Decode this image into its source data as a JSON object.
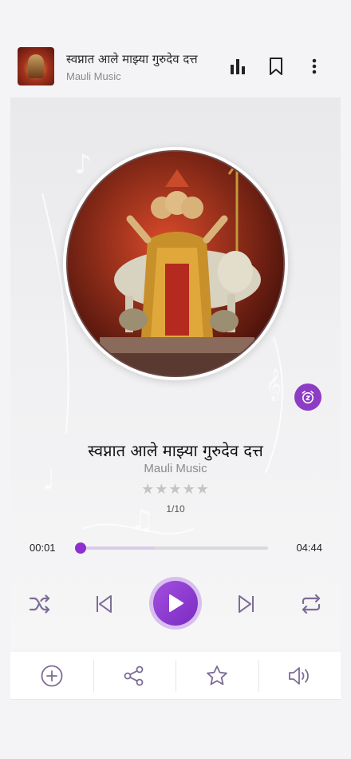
{
  "header": {
    "title": "स्वप्नात आले माझ्या गुरुदेव दत्त",
    "artist": "Mauli Music",
    "icons": [
      "equalizer-icon",
      "bookmark-icon",
      "more-vert-icon"
    ]
  },
  "player": {
    "title": "स्वप्नात आले माझ्या गुरुदेव दत्त",
    "artist": "Mauli Music",
    "rating": 0,
    "stars": "★★★★★",
    "track_position": "1/10",
    "current_time": "00:01",
    "duration": "04:44",
    "progress": 0.004,
    "buffered": 0.4,
    "controls": [
      "shuffle-icon",
      "previous-icon",
      "play-icon",
      "next-icon",
      "repeat-icon"
    ],
    "accent_color": "#8e2fd0"
  },
  "actions": [
    "add-icon",
    "share-icon",
    "star-icon",
    "volume-icon"
  ]
}
